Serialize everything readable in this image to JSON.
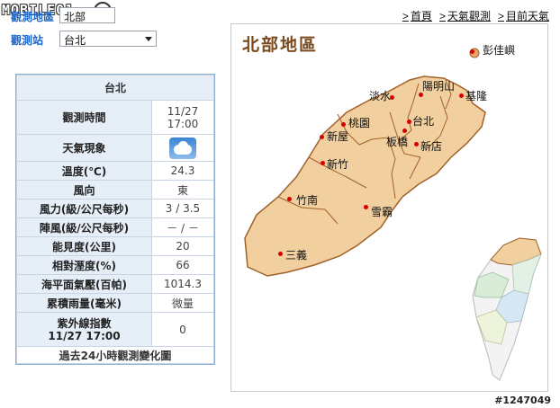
{
  "logo": {
    "text": "MOBILE01"
  },
  "selectors": [
    {
      "label": "觀測地區",
      "value": "北部"
    },
    {
      "label": "觀測站",
      "value": "台北"
    }
  ],
  "nav": [
    "首頁",
    "天氣觀測",
    "目前天氣"
  ],
  "station": {
    "name": "台北",
    "rows": [
      {
        "label": "觀測時間",
        "value": "11/27\n17:00"
      },
      {
        "label": "天氣現象",
        "icon": "cloudy-icon"
      },
      {
        "label": "溫度(℃)",
        "value": "24.3"
      },
      {
        "label": "風向",
        "value": "東"
      },
      {
        "label": "風力(級/公尺每秒)",
        "value": "3 / 3.5"
      },
      {
        "label": "陣風(級/公尺每秒)",
        "value": "－ / －"
      },
      {
        "label": "能見度(公里)",
        "value": "20"
      },
      {
        "label": "相對溼度(%)",
        "value": "66"
      },
      {
        "label": "海平面氣壓(百帕)",
        "value": "1014.3"
      },
      {
        "label": "累積雨量(毫米)",
        "value": "微量"
      },
      {
        "label": "紫外線指數\n11/27 17:00",
        "value": "0"
      }
    ],
    "footer": "過去24小時觀測變化圖"
  },
  "map": {
    "title": "北部地區",
    "colors": {
      "land": "#f1cf9e",
      "border": "#a0612a",
      "dot": "#d60000"
    },
    "cities": [
      "彭佳嶼",
      "淡水",
      "陽明山",
      "基隆",
      "台北",
      "桃園",
      "新屋",
      "板橋",
      "新店",
      "新竹",
      "竹南",
      "雪霸",
      "三義"
    ]
  },
  "watermark": "#1247049"
}
